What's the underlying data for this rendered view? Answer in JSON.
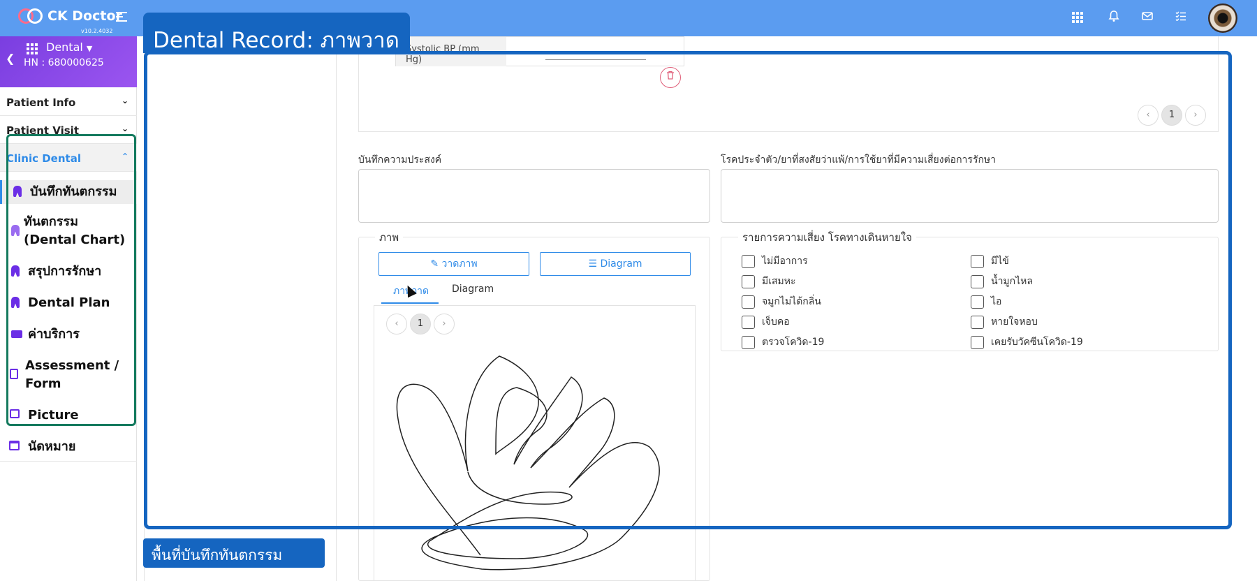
{
  "app": {
    "name": "CK Doctor",
    "version": "v10.2.4032"
  },
  "sidebar": {
    "clinic": "Dental",
    "hn": "HN : 680000625",
    "sections": [
      {
        "label": "Patient Info"
      },
      {
        "label": "Patient Visit"
      },
      {
        "label": "Clinic Dental"
      }
    ],
    "items": [
      {
        "label": "บันทึกทันตกรรม"
      },
      {
        "label_line1": "ทันตกรรม",
        "label_line2": "(Dental Chart)"
      },
      {
        "label": "สรุปการรักษา"
      },
      {
        "label": "Dental Plan"
      },
      {
        "label": "ค่าบริการ"
      },
      {
        "label_line1": "Assessment /",
        "label_line2": "Form"
      },
      {
        "label": "Picture"
      },
      {
        "label": "นัดหมาย"
      }
    ]
  },
  "vitals": {
    "partial_label": "Systolic BP (mm Hg)"
  },
  "pager_top": {
    "current": "1"
  },
  "forms": {
    "purpose_label": "บันทึกความประสงค์",
    "risk_label": "โรคประจำตัว/ยาที่สงสัยว่าแพ้/การใช้ยาที่มีความเสี่ยงต่อการรักษา"
  },
  "picture": {
    "legend": "ภาพ",
    "draw_button": "วาดภาพ",
    "diagram_button": "Diagram",
    "tabs": [
      "ภาพวาด",
      "Diagram"
    ],
    "pager_current": "1"
  },
  "risk_list": {
    "legend": "รายการความเสี่ยง โรคทางเดินหายใจ",
    "left": [
      "ไม่มีอาการ",
      "มีเสมหะ",
      "จมูกไม่ได้กลิ่น",
      "เจ็บคอ",
      "ตรวจโควิด-19"
    ],
    "right": [
      "มีไข้",
      "น้ำมูกไหล",
      "ไอ",
      "หายใจหอบ",
      "เคยรับวัคซีนโควิด-19"
    ]
  },
  "annotations": {
    "title": "Dental Record: ภาพวาด",
    "bottom_label": "พื้นที่บันทึกทันตกรรม"
  },
  "colors": {
    "topbar": "#5b9cf0",
    "accent": "#2f8be8",
    "annotation": "#1565c0",
    "sidebar_highlight": "#147a5e",
    "icon_purple": "#6b2ee6"
  }
}
